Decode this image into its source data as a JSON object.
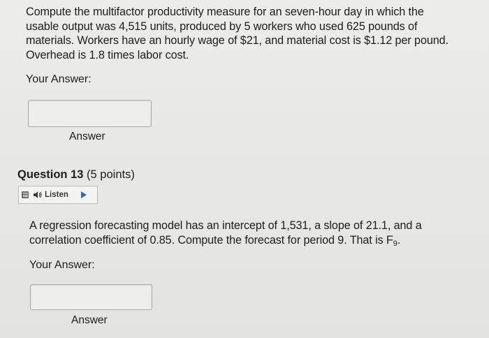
{
  "question12": {
    "text": "Compute the multifactor productivity measure for an seven-hour day in which the usable output was 4,515 units, produced by 5 workers who used 625 pounds of materials. Workers have an hourly wage of $21, and material cost is $1.12 per pound. Overhead is 1.8 times labor cost.",
    "your_answer_label": "Your Answer:",
    "answer_value": "",
    "answer_label": "Answer"
  },
  "question13": {
    "title": "Question 13",
    "points": "(5 points)",
    "listen": {
      "label": "Listen",
      "icons": [
        "menu-icon",
        "speaker-icon",
        "play-icon"
      ]
    },
    "text_main": "A regression forecasting model has an intercept of 1,531, a slope of 21.1, and a correlation coefficient of 0.85. Compute the forecast for period 9. That is F",
    "text_subscript": "9",
    "text_end": ".",
    "your_answer_label": "Your Answer:",
    "answer_value": "",
    "answer_label": "Answer"
  },
  "colors": {
    "background": "#e9e9e7",
    "text": "#1d1d1d",
    "play_accent": "#2a6db5",
    "input_border": "#a9a9a6"
  }
}
